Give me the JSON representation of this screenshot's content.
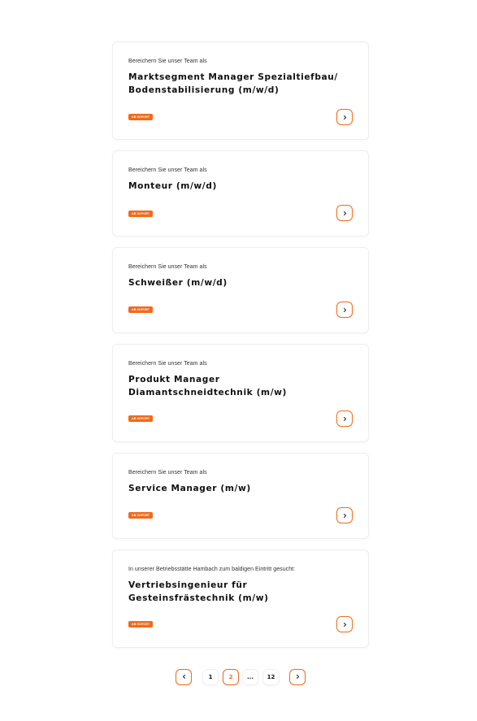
{
  "jobs": [
    {
      "intro": "Bereichern Sie unser Team als",
      "title": "Marktsegment Manager Spezialtiefbau/ Bodenstabilisierung (m/w/d)",
      "badge": "AB SOFORT"
    },
    {
      "intro": "Bereichern Sie unser Team als",
      "title": "Monteur (m/w/d)",
      "badge": "AB SOFORT"
    },
    {
      "intro": "Bereichern Sie unser Team als",
      "title": "Schweißer (m/w/d)",
      "badge": "AB SOFORT"
    },
    {
      "intro": "Bereichern Sie unser Team als",
      "title": "Produkt Manager Diamantschneidtechnik (m/w)",
      "badge": "AB SOFORT"
    },
    {
      "intro": "Bereichern Sie unser Team als",
      "title": "Service Manager (m/w)",
      "badge": "AB SOFORT"
    },
    {
      "intro": "In unserer Betriebsstätte Hambach zum baldigen Eintritt gesucht:",
      "title": "Vertriebsingenieur für Gesteinsfrästechnik (m/w)",
      "badge": "AB SOFORT"
    }
  ],
  "pagination": {
    "pages": [
      "1",
      "2",
      "...",
      "12"
    ],
    "current": "2"
  },
  "colors": {
    "accent": "#f26a1b",
    "text": "#111111",
    "border": "#eeeeee"
  },
  "icons": {
    "next": "chevron-right-icon",
    "prev": "chevron-left-icon"
  }
}
